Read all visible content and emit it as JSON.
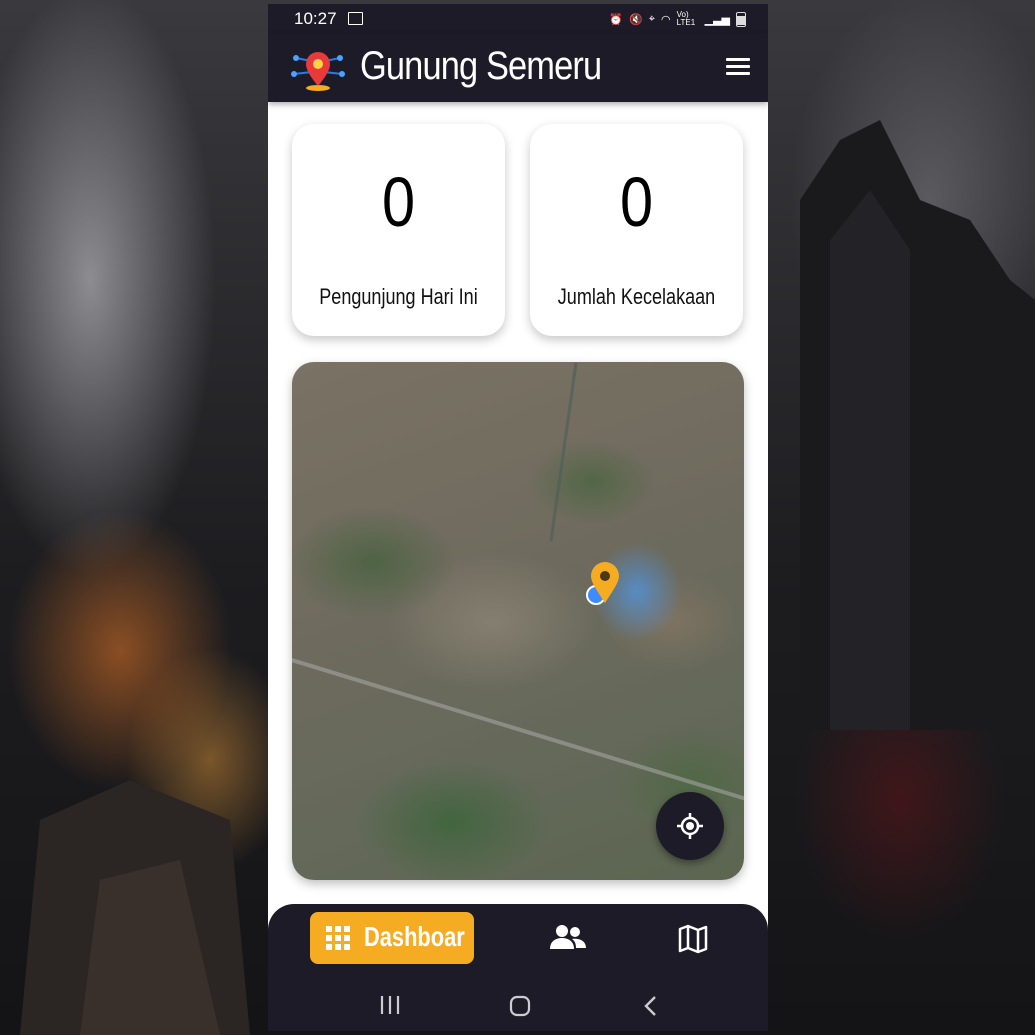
{
  "status_bar": {
    "time": "10:27",
    "icons": [
      "image-icon",
      "alarm-icon",
      "mute-icon",
      "location-icon",
      "wifi-icon",
      "lte-icon",
      "signal-icon",
      "battery-icon"
    ],
    "network_label": "Vo) LTE1"
  },
  "app_bar": {
    "title": "Gunung Semeru",
    "logo_icon": "map-pin-network-icon",
    "menu_icon": "hamburger-menu-icon"
  },
  "stats": [
    {
      "value": "0",
      "label": "Pengunjung Hari Ini"
    },
    {
      "value": "0",
      "label": "Jumlah Kecelakaan"
    }
  ],
  "map": {
    "type": "satellite",
    "pin_color": "#f6ac22",
    "locate_button_icon": "my-location-icon"
  },
  "bottom_nav": {
    "items": [
      {
        "label": "Dashboar",
        "icon": "grid-icon",
        "active": true
      },
      {
        "label": "",
        "icon": "people-icon",
        "active": false
      },
      {
        "label": "",
        "icon": "map-icon",
        "active": false
      }
    ]
  },
  "system_nav": {
    "icons": [
      "recents-icon",
      "home-icon",
      "back-icon"
    ]
  },
  "colors": {
    "bar_background": "#1e1b29",
    "accent": "#f6ac22",
    "card_background": "#ffffff"
  }
}
